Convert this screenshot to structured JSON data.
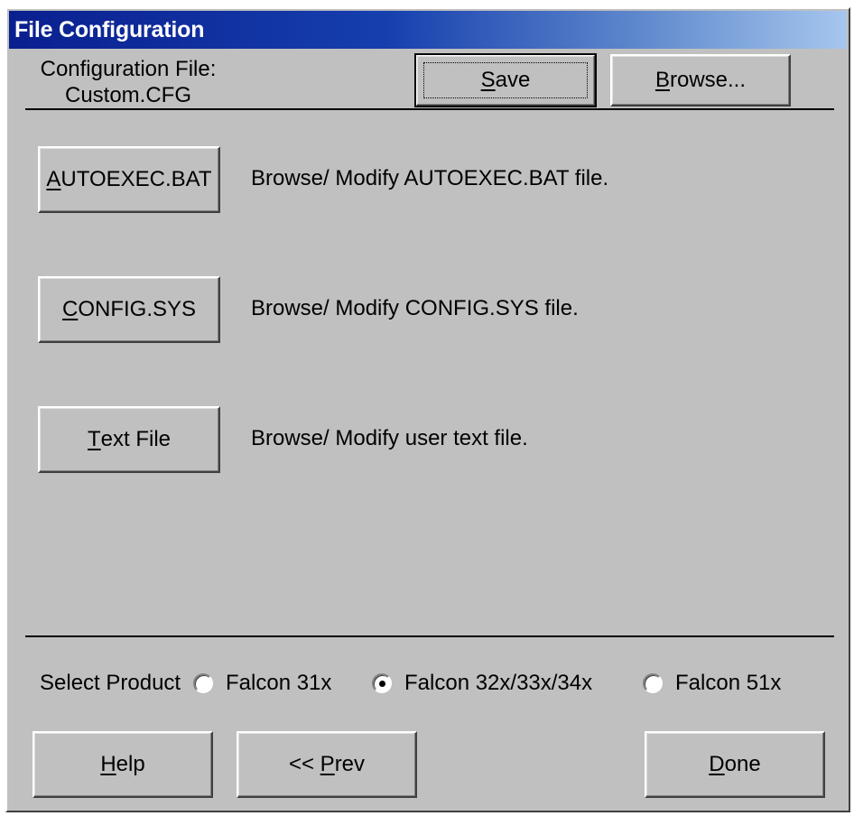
{
  "window": {
    "title": "File Configuration"
  },
  "config": {
    "label_line1": "Configuration File:",
    "label_line2": "Custom.CFG",
    "save_mnemonic": "S",
    "save_rest": "ave",
    "browse_mnemonic": "B",
    "browse_rest": "rowse..."
  },
  "files": [
    {
      "button_mnemonic": "A",
      "button_rest": "UTOEXEC.BAT",
      "description": "Browse/ Modify AUTOEXEC.BAT file."
    },
    {
      "button_mnemonic": "C",
      "button_rest": "ONFIG.SYS",
      "description": "Browse/ Modify CONFIG.SYS file."
    },
    {
      "button_mnemonic": "T",
      "button_rest": "ext File",
      "description": "Browse/ Modify user text file."
    }
  ],
  "product": {
    "label": "Select Product",
    "options": [
      {
        "label": "Falcon 31x",
        "checked": false
      },
      {
        "label": "Falcon 32x/33x/34x",
        "checked": true
      },
      {
        "label": "Falcon 51x",
        "checked": false
      }
    ]
  },
  "footer": {
    "help_mnemonic": "H",
    "help_rest": "elp",
    "prev_prefix": "<< ",
    "prev_mnemonic": "P",
    "prev_rest": "rev",
    "done_mnemonic": "D",
    "done_rest": "one"
  }
}
